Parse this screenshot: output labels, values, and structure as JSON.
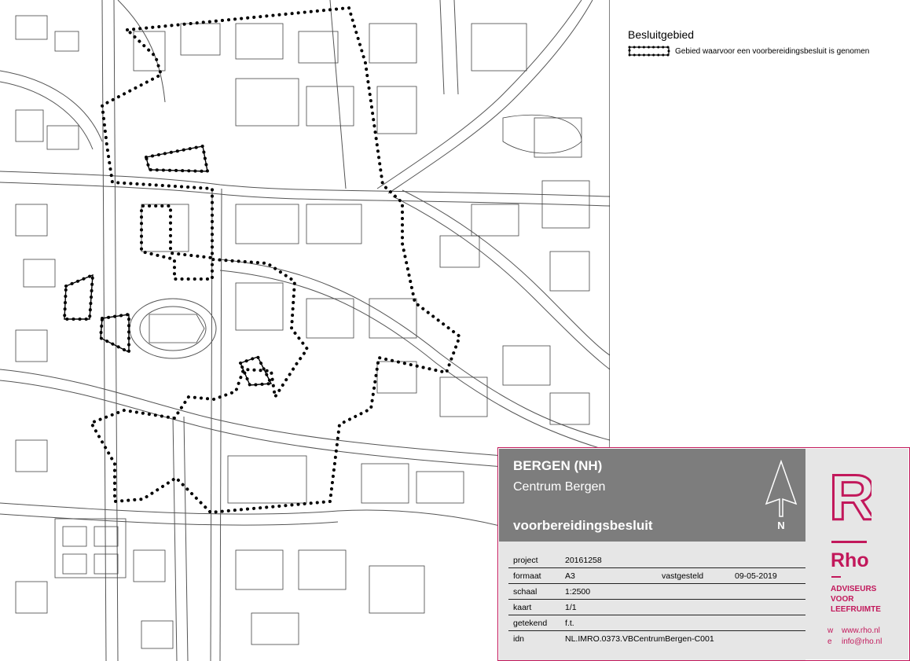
{
  "legend": {
    "title": "Besluitgebied",
    "item_label": "Gebied waarvoor een voorbereidingsbesluit is genomen"
  },
  "titleblock": {
    "city": "BERGEN (NH)",
    "area": "Centrum Bergen",
    "decision": "voorbereidingsbesluit",
    "north": "N",
    "rows": {
      "project_label": "project",
      "project_value": "20161258",
      "format_label": "formaat",
      "format_value": "A3",
      "fixed_label": "vastgesteld",
      "fixed_value": "09-05-2019",
      "scale_label": "schaal",
      "scale_value": "1:2500",
      "map_label": "kaart",
      "map_value": "1/1",
      "drawn_label": "getekend",
      "drawn_value": "f.t.",
      "idn_label": "idn",
      "idn_value": "NL.IMRO.0373.VBCentrumBergen-C001"
    },
    "brand": {
      "logo_letter": "R",
      "name": "Rho",
      "tag1": "ADVISEURS",
      "tag2": "VOOR",
      "tag3": "LEEFRUIMTE",
      "web_key": "w",
      "web": "www.rho.nl",
      "email_key": "e",
      "email": "info@rho.nl"
    }
  },
  "colors": {
    "accent": "#c2185b",
    "boundary": "#000000",
    "header_grey": "#7d7d7d",
    "panel_grey": "#e6e6e6"
  }
}
